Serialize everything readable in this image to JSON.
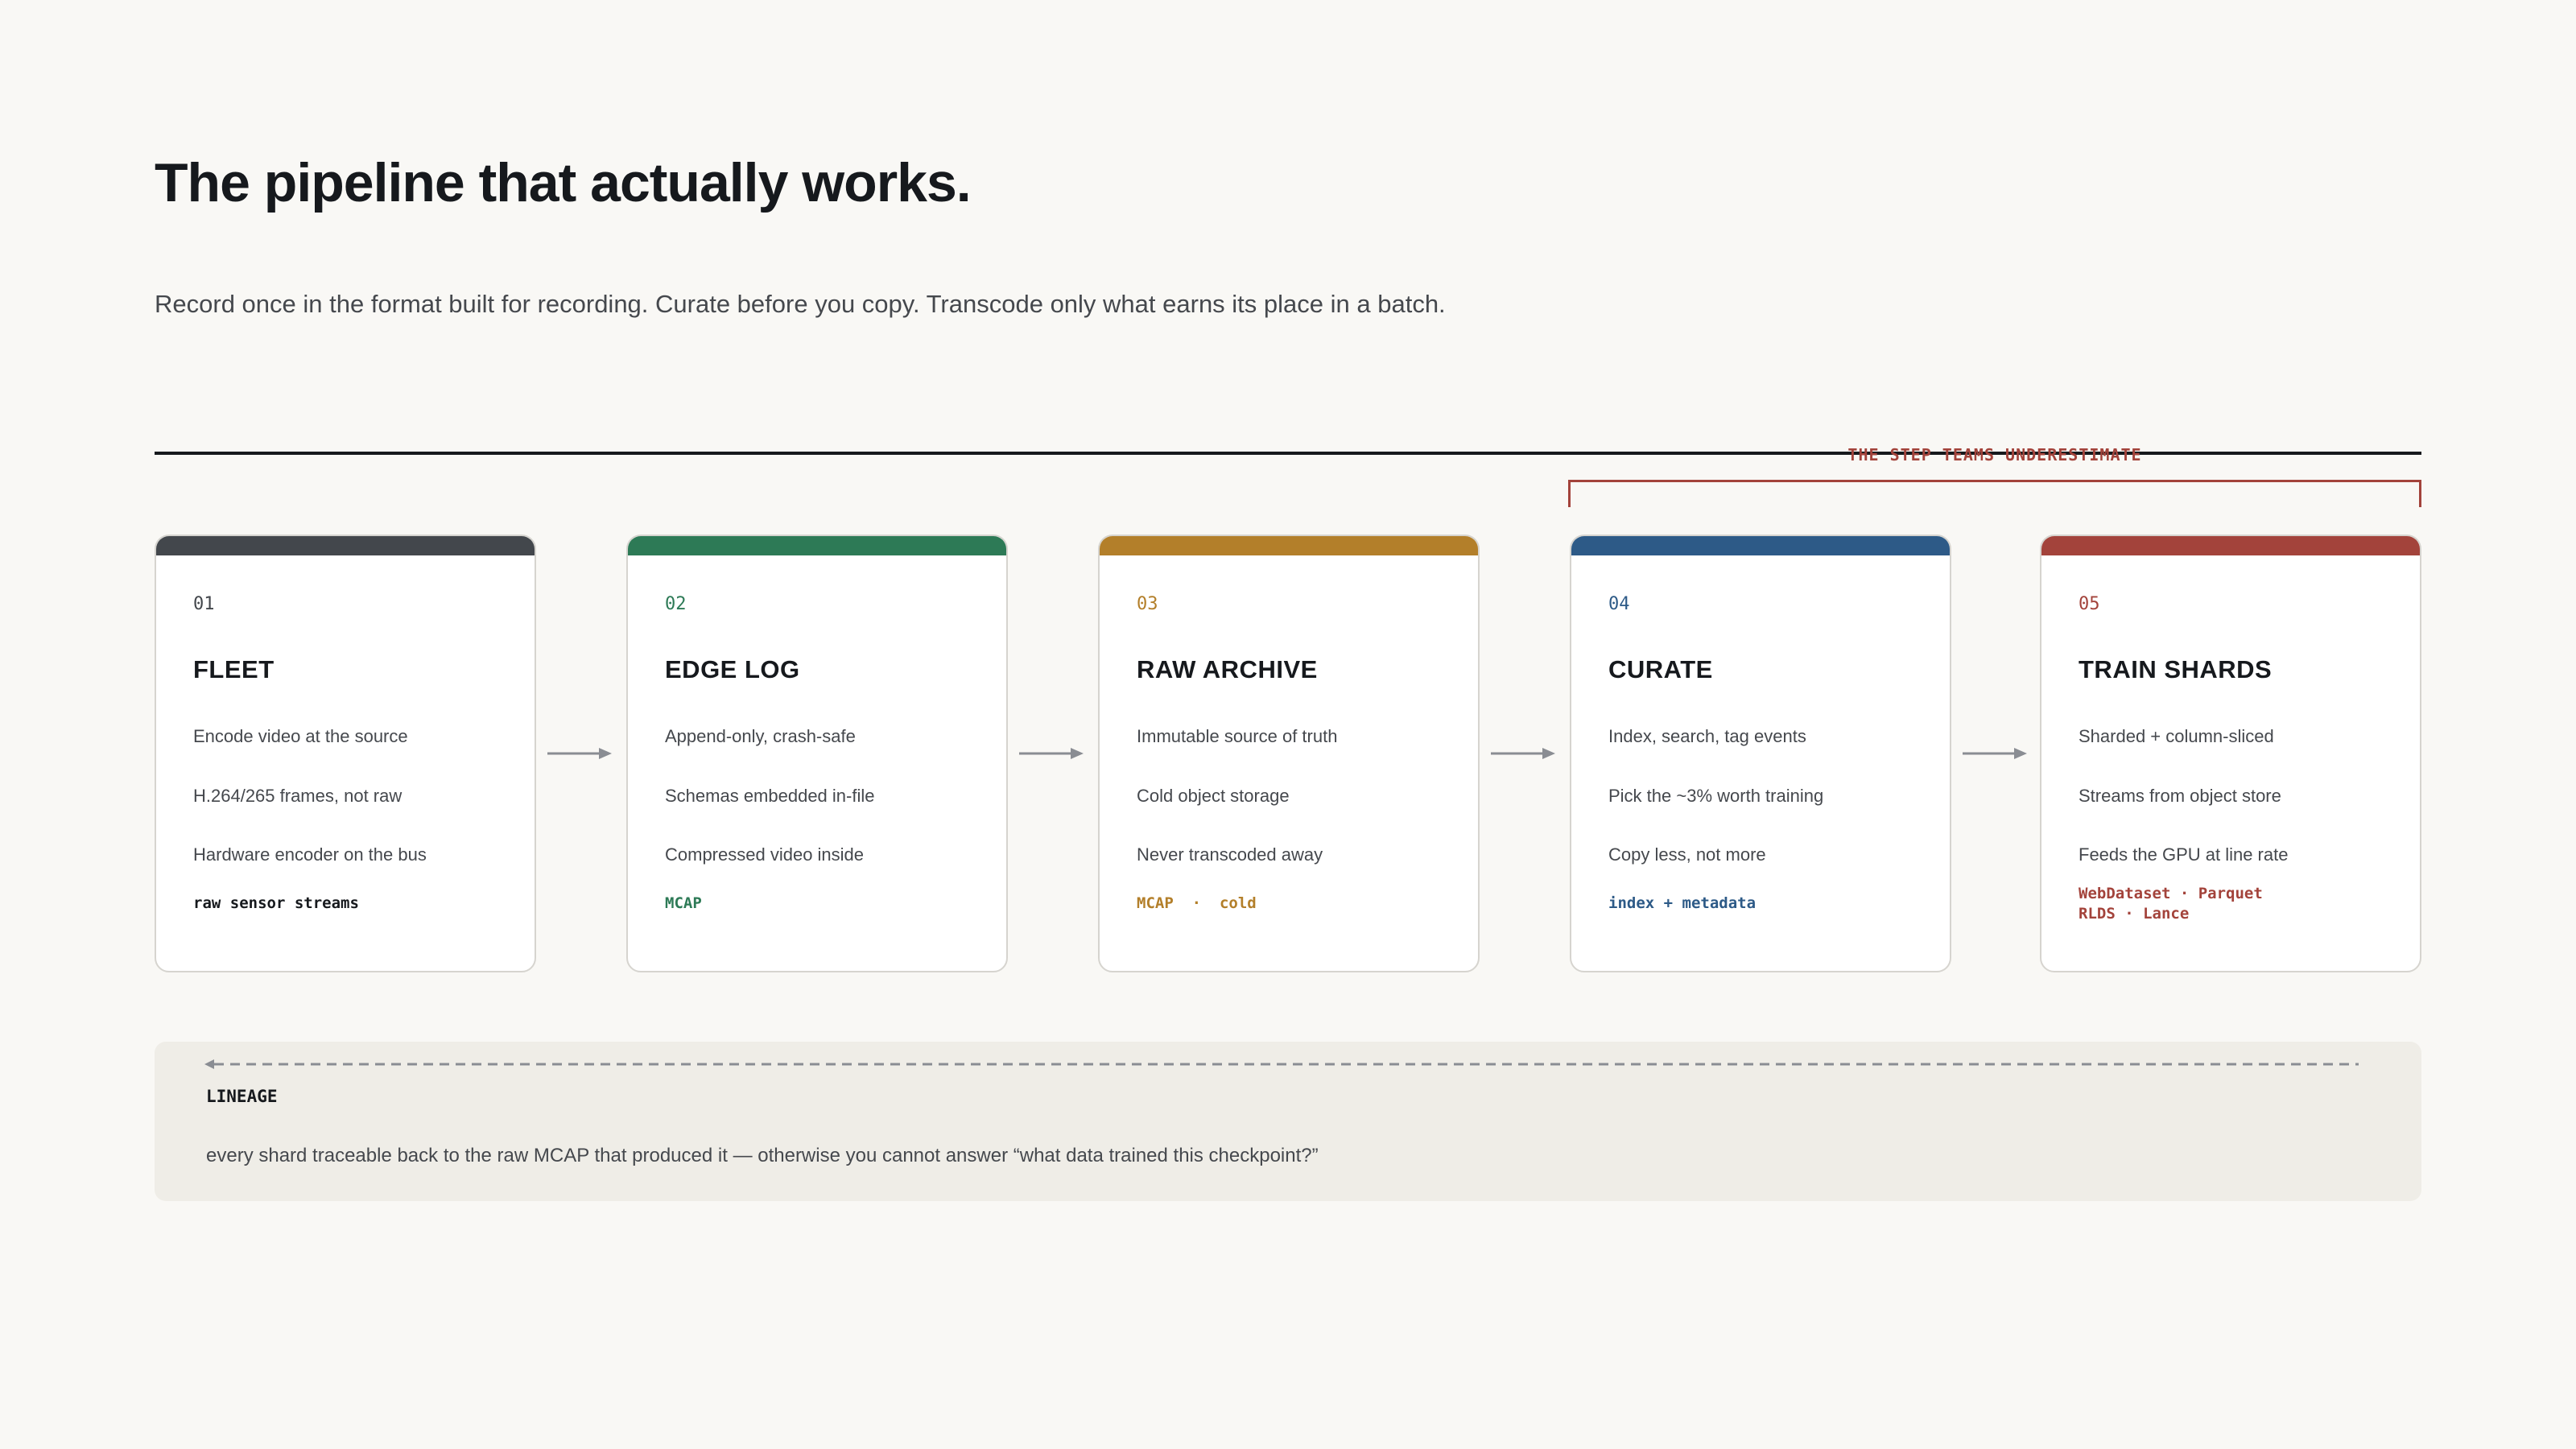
{
  "header": {
    "title": "The pipeline that actually works.",
    "subtitle": "Record once in the format built for recording. Curate before you copy. Transcode only what earns its place in a batch."
  },
  "bracket": {
    "label": "THE STEP TEAMS UNDERESTIMATE",
    "color": "#a3433b"
  },
  "stages": [
    {
      "num": "01",
      "title": "FLEET",
      "color": "#43474c",
      "text_color": "#43474c",
      "lines": [
        "Encode video at the source",
        "H.264/265 frames, not raw",
        "Hardware encoder on the bus"
      ],
      "tag": "raw sensor streams"
    },
    {
      "num": "02",
      "title": "EDGE LOG",
      "color": "#2d7a56",
      "text_color": "#2d7a56",
      "lines": [
        "Append-only, crash-safe",
        "Schemas embedded in-file",
        "Compressed video inside"
      ],
      "tag": "MCAP"
    },
    {
      "num": "03",
      "title": "RAW ARCHIVE",
      "color": "#b37f2a",
      "text_color": "#b37f2a",
      "lines": [
        "Immutable source of truth",
        "Cold object storage",
        "Never transcoded away"
      ],
      "tag": "MCAP  ·  cold"
    },
    {
      "num": "04",
      "title": "CURATE",
      "color": "#2d5a87",
      "text_color": "#2d5a87",
      "lines": [
        "Index, search, tag events",
        "Pick the ~3% worth training",
        "Copy less, not more"
      ],
      "tag": "index + metadata"
    },
    {
      "num": "05",
      "title": "TRAIN SHARDS",
      "color": "#a3433b",
      "text_color": "#a3433b",
      "lines": [
        "Sharded + column-sliced",
        "Streams from object store",
        "Feeds the GPU at line rate"
      ],
      "tag": "WebDataset · Parquet\nRLDS · Lance"
    }
  ],
  "lineage": {
    "label": "LINEAGE",
    "text": "every shard traceable back to the raw MCAP that produced it — otherwise you cannot answer “what data trained this checkpoint?”"
  },
  "colors": {
    "background": "#f9f8f5",
    "arrow": "#8a8d93",
    "card_border": "#d6d4cf",
    "lineage_bg": "#efede7"
  }
}
